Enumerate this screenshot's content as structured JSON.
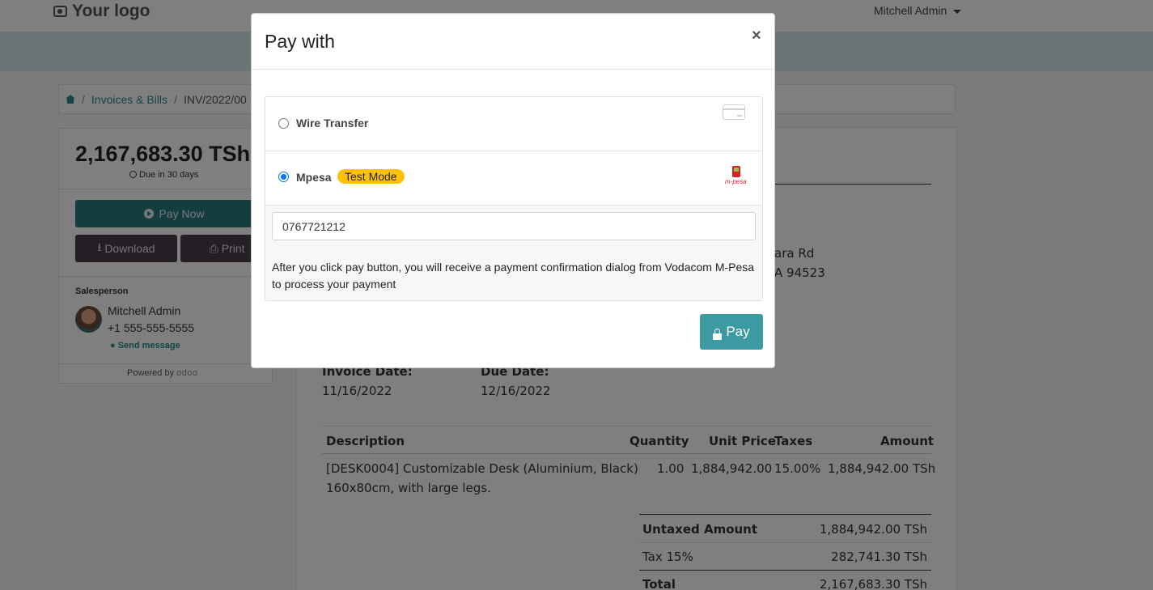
{
  "header": {
    "logo": "Your logo",
    "user_menu": "Mitchell Admin"
  },
  "breadcrumb": {
    "sep1": "/",
    "link": "Invoices & Bills",
    "sep2": "/",
    "current": "INV/2022/00"
  },
  "sidebar": {
    "amount": "2,167,683.30 TSh",
    "due": "Due in 30 days",
    "pay_now": "Pay Now",
    "download": "Download",
    "print": "Print",
    "salesperson_label": "Salesperson",
    "salesperson_name": "Mitchell Admin",
    "salesperson_phone": "+1 555-555-5555",
    "send_message": "Send message",
    "powered_by": "Powered by",
    "powered_brand": "odoo"
  },
  "invoice": {
    "address_line1": "ara Rd",
    "address_line2": "A 94523",
    "invoice_date_label": "Invoice Date:",
    "invoice_date": "11/16/2022",
    "due_date_label": "Due Date:",
    "due_date": "12/16/2022",
    "columns": [
      "Description",
      "Quantity",
      "Unit Price",
      "Taxes",
      "Amount"
    ],
    "line": {
      "description_1": "[DESK0004] Customizable Desk (Aluminium, Black)",
      "description_2": "160x80cm, with large legs.",
      "quantity": "1.00",
      "unit_price": "1,884,942.00",
      "taxes": "15.00%",
      "amount": "1,884,942.00 TSh"
    },
    "untaxed_label": "Untaxed Amount",
    "untaxed_value": "1,884,942.00 TSh",
    "tax_label": "Tax 15%",
    "tax_value": "282,741.30 TSh",
    "total_label": "Total",
    "total_value": "2,167,683.30 TSh"
  },
  "modal": {
    "title": "Pay with",
    "close": "×",
    "methods": [
      {
        "name": "Wire Transfer",
        "selected": false,
        "icon": "credit-card-icon"
      },
      {
        "name": "Mpesa",
        "badge": "Test Mode",
        "selected": true,
        "icon": "mpesa-logo-icon",
        "logo_text": "m-pesa"
      }
    ],
    "phone_value": "0767721212",
    "note": "After you click pay button, you will receive a payment confirmation dialog from Vodacom M-Pesa to process your payment",
    "pay_button": "Pay"
  },
  "colors": {
    "teal": "#2b7a80",
    "pay_button": "#3c9aa2",
    "badge": "#ffc107",
    "dark_button": "#4b3e4b"
  }
}
